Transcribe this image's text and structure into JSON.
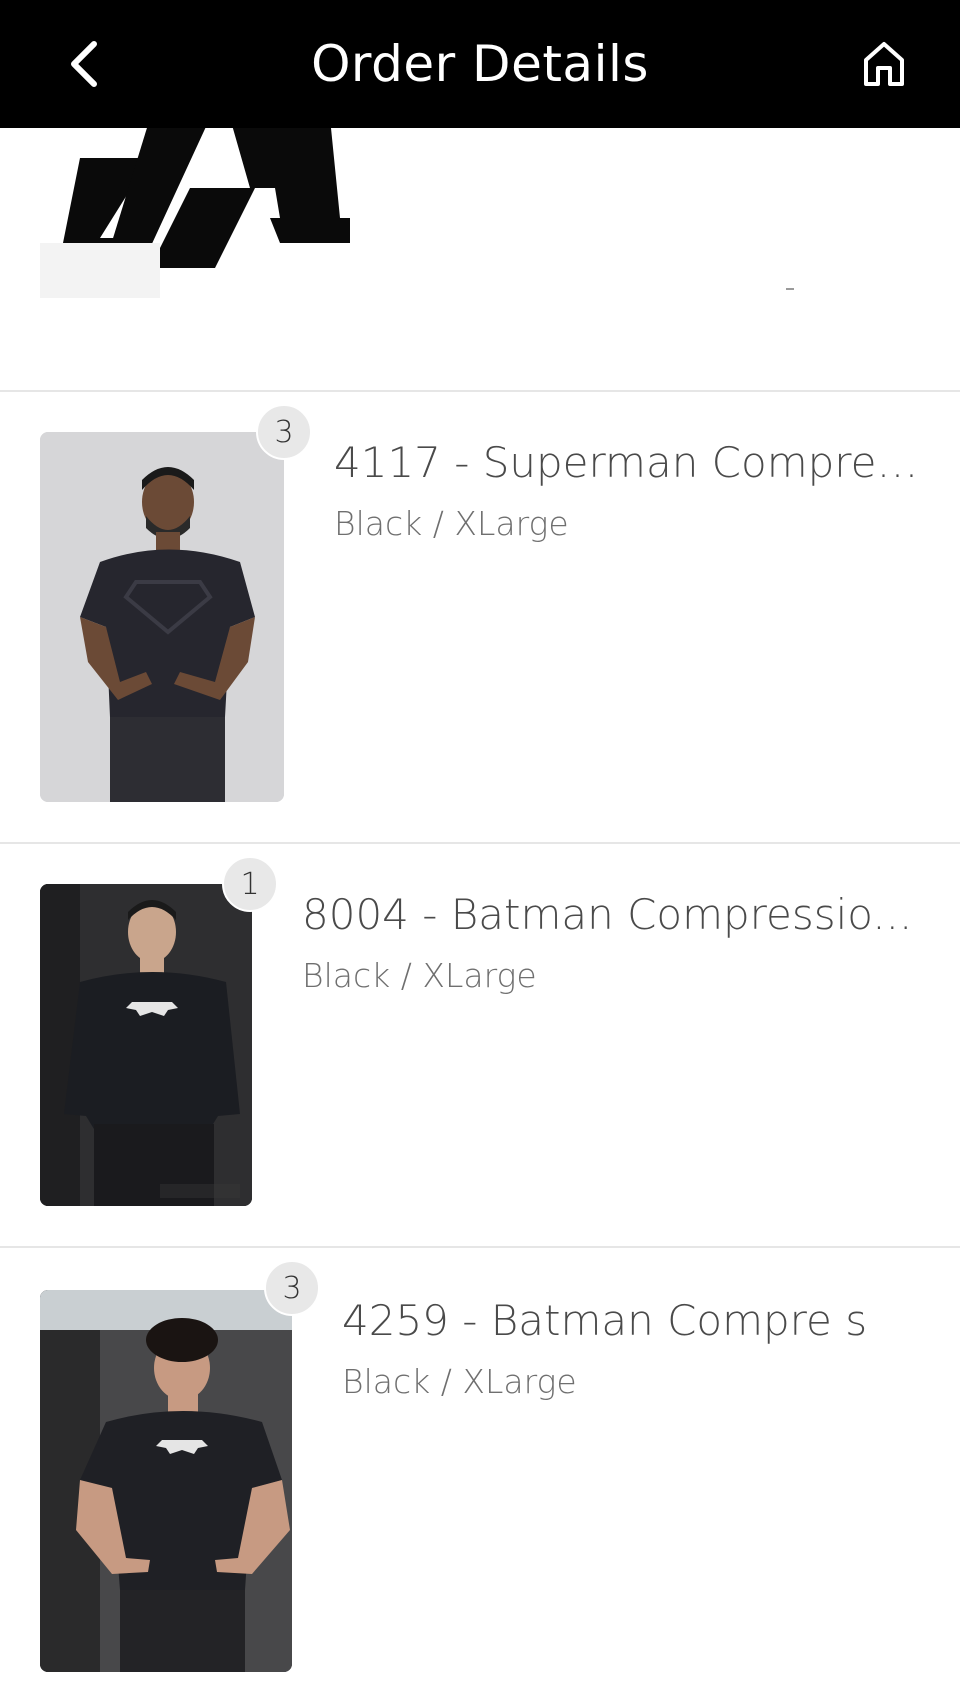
{
  "header": {
    "title": "Order Details",
    "back_icon": "chevron-left-icon",
    "home_icon": "home-icon"
  },
  "colors": {
    "header_bg": "#000000",
    "header_text": "#ffffff",
    "divider": "#e6e6e6",
    "badge_bg": "#e8e8e8",
    "item_text": "#4a4a4a",
    "variant_text": "#6f6f6f"
  },
  "items": [
    {
      "quantity": "3",
      "name": "4117 - Superman Compres...",
      "variant": "Black / XLarge"
    },
    {
      "quantity": "1",
      "name": "8004 - Batman Compressio...",
      "variant": "Black / XLarge"
    },
    {
      "quantity": "3",
      "name": "4259 - Batman Compre  s",
      "variant": "Black / XLarge"
    }
  ]
}
